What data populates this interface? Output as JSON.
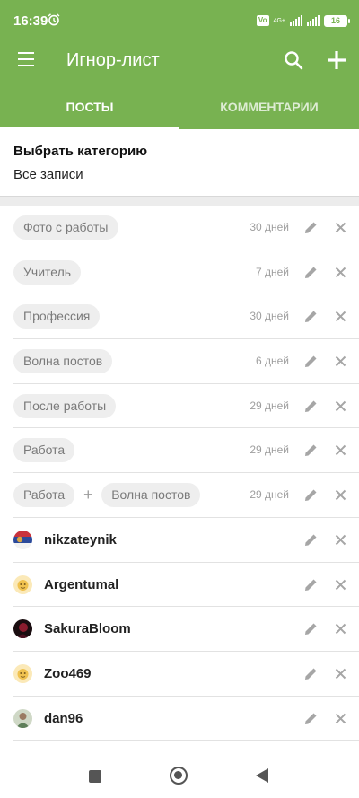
{
  "status_bar": {
    "time": "16:39",
    "network": "4G+",
    "volte": "Vo",
    "battery": "16"
  },
  "app_bar": {
    "title": "Игнор-лист",
    "icons": [
      "menu-icon",
      "search-icon",
      "add-icon"
    ]
  },
  "tabs": [
    {
      "label": "ПОСТЫ",
      "active": true
    },
    {
      "label": "КОММЕНТАРИИ",
      "active": false
    }
  ],
  "category": {
    "label": "Выбрать категорию",
    "value": "Все записи"
  },
  "tag_rows": [
    {
      "tags": [
        "Фото с работы"
      ],
      "days": "30 дней"
    },
    {
      "tags": [
        "Учитель"
      ],
      "days": "7 дней"
    },
    {
      "tags": [
        "Профессия"
      ],
      "days": "30 дней"
    },
    {
      "tags": [
        "Волна постов"
      ],
      "days": "6 дней"
    },
    {
      "tags": [
        "После работы"
      ],
      "days": "29 дней"
    },
    {
      "tags": [
        "Работа"
      ],
      "days": "29 дней"
    },
    {
      "tags": [
        "Работа",
        "Волна постов"
      ],
      "days": "29 дней"
    }
  ],
  "user_rows": [
    {
      "name": "nikzateynik",
      "avatar": "flag"
    },
    {
      "name": "Argentumal",
      "avatar": "default"
    },
    {
      "name": "SakuraBloom",
      "avatar": "dark"
    },
    {
      "name": "Zoo469",
      "avatar": "default"
    },
    {
      "name": "dan96",
      "avatar": "photo"
    }
  ],
  "colors": {
    "accent": "#78b251",
    "chip_bg": "#eeeeee",
    "icon_gray": "#a6a6a6"
  }
}
